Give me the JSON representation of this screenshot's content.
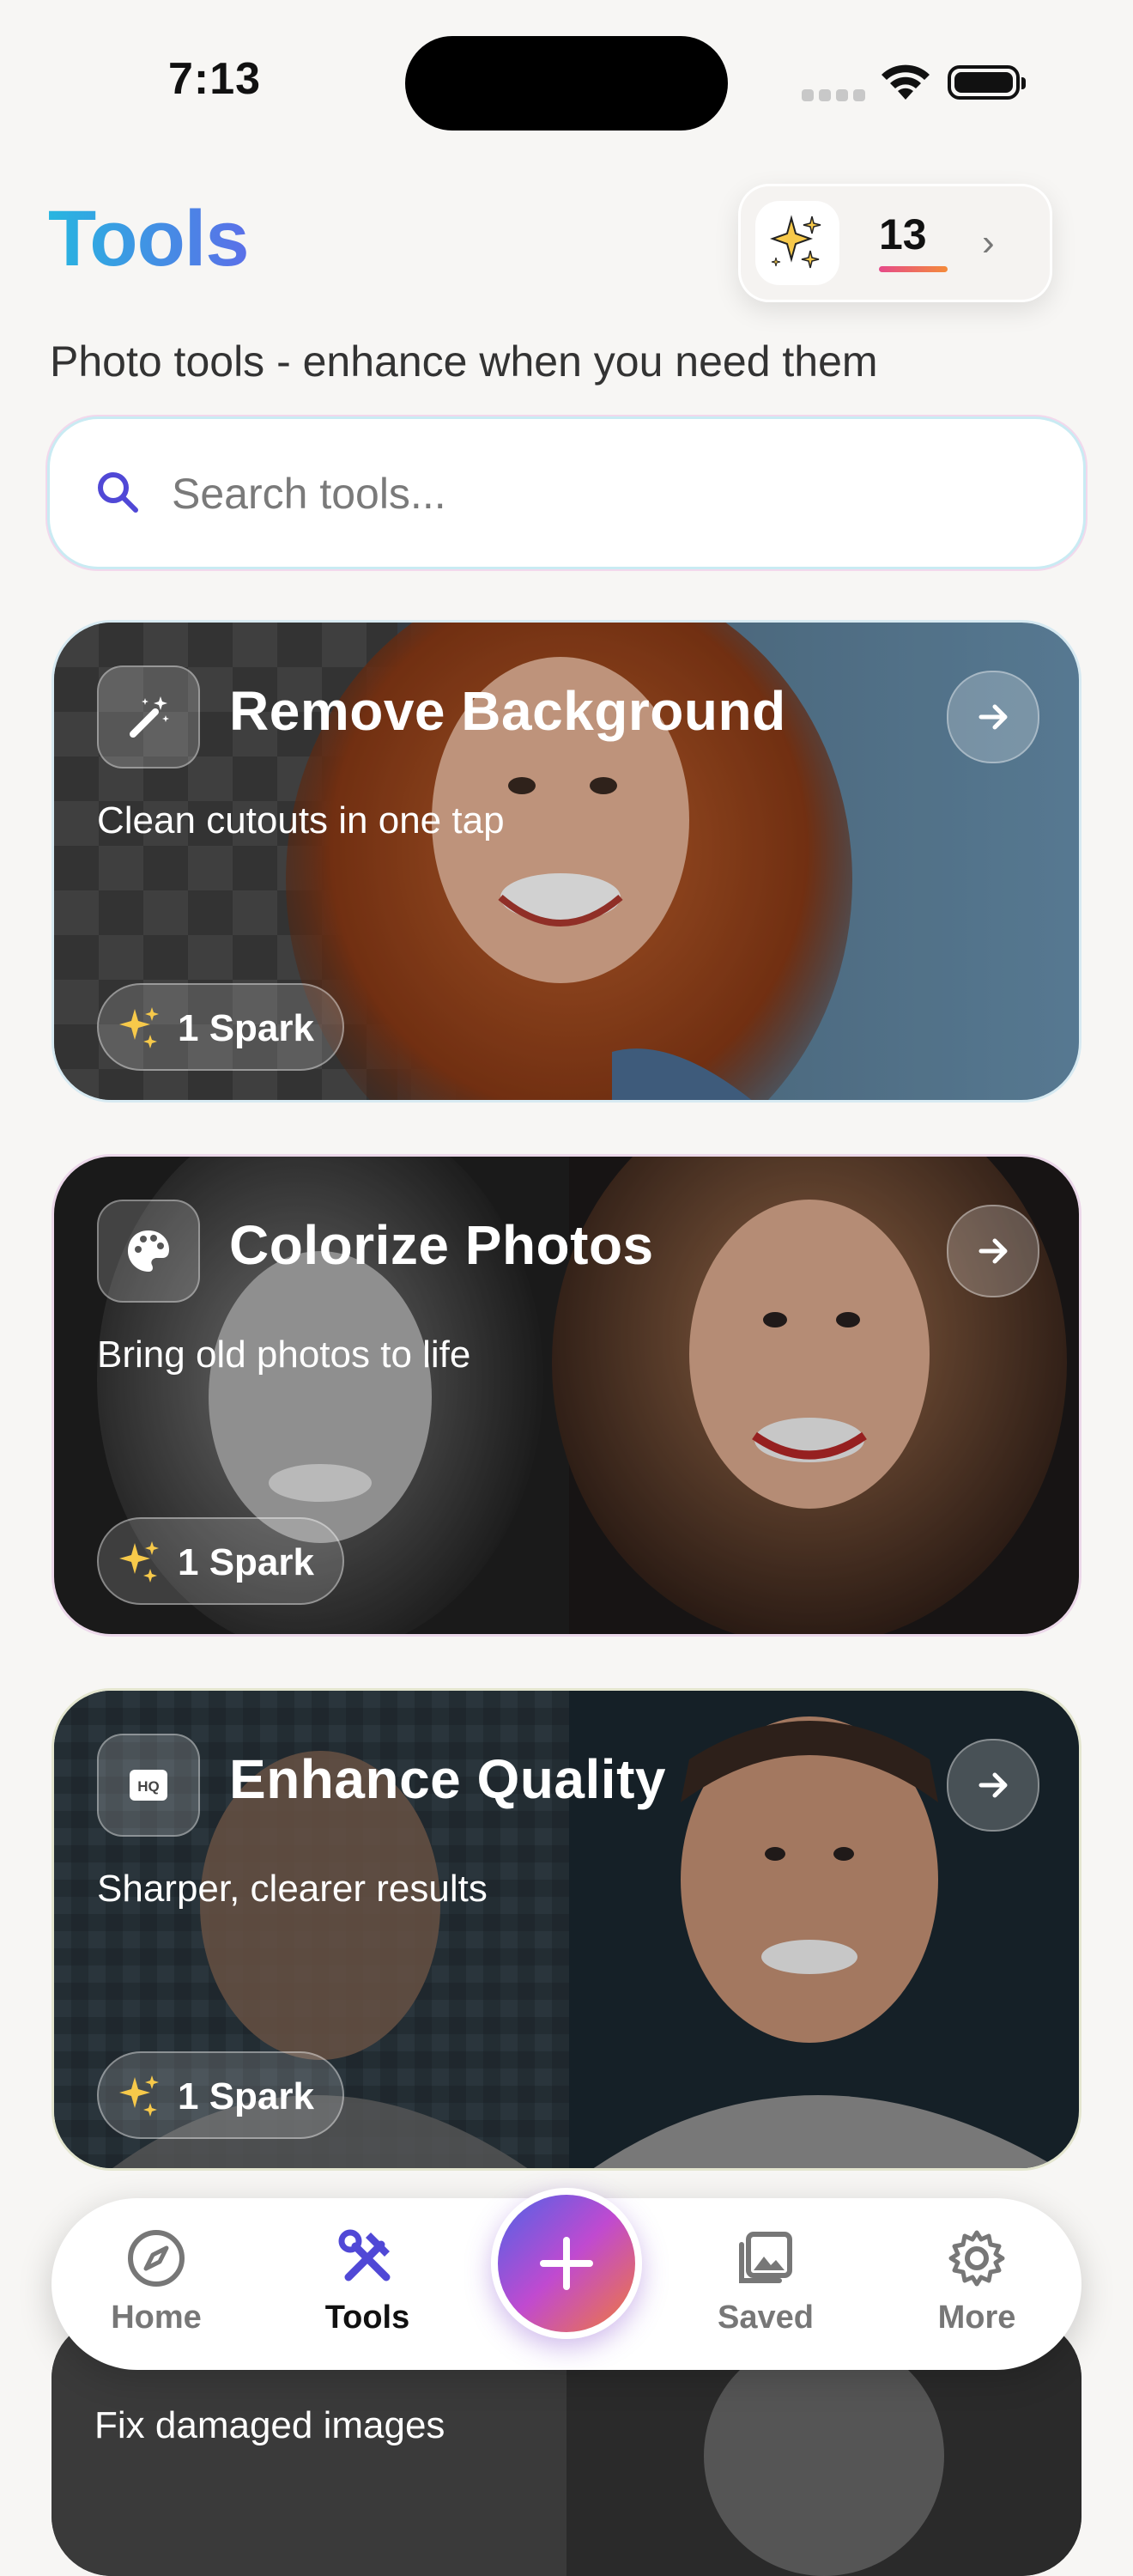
{
  "status_bar": {
    "time": "7:13"
  },
  "header": {
    "title": "Tools",
    "subtitle": "Photo tools - enhance when you need them",
    "spark_balance": "13"
  },
  "search": {
    "placeholder": "Search tools..."
  },
  "tools": [
    {
      "title": "Remove Background",
      "subtitle": "Clean cutouts in one tap",
      "cost": "1 Spark",
      "icon": "magic-wand-icon"
    },
    {
      "title": "Colorize Photos",
      "subtitle": "Bring old photos to life",
      "cost": "1 Spark",
      "icon": "palette-icon"
    },
    {
      "title": "Enhance Quality",
      "subtitle": "Sharper, clearer results",
      "cost": "1 Spark",
      "icon": "hq-icon"
    },
    {
      "subtitle": "Fix damaged images"
    }
  ],
  "tab_bar": {
    "items": [
      {
        "label": "Home",
        "icon": "compass-icon",
        "active": false
      },
      {
        "label": "Tools",
        "icon": "hammer-wrench-icon",
        "active": true
      },
      {
        "label": "Saved",
        "icon": "gallery-icon",
        "active": false
      },
      {
        "label": "More",
        "icon": "gear-icon",
        "active": false
      }
    ],
    "center_button_icon": "plus-icon"
  },
  "colors": {
    "accent": "#5b6fe8",
    "title_gradient_start": "#27b6e0",
    "title_gradient_end": "#5b6fe8",
    "fab_gradient": [
      "#4f63e6",
      "#c04ad0",
      "#f07a3a"
    ]
  }
}
